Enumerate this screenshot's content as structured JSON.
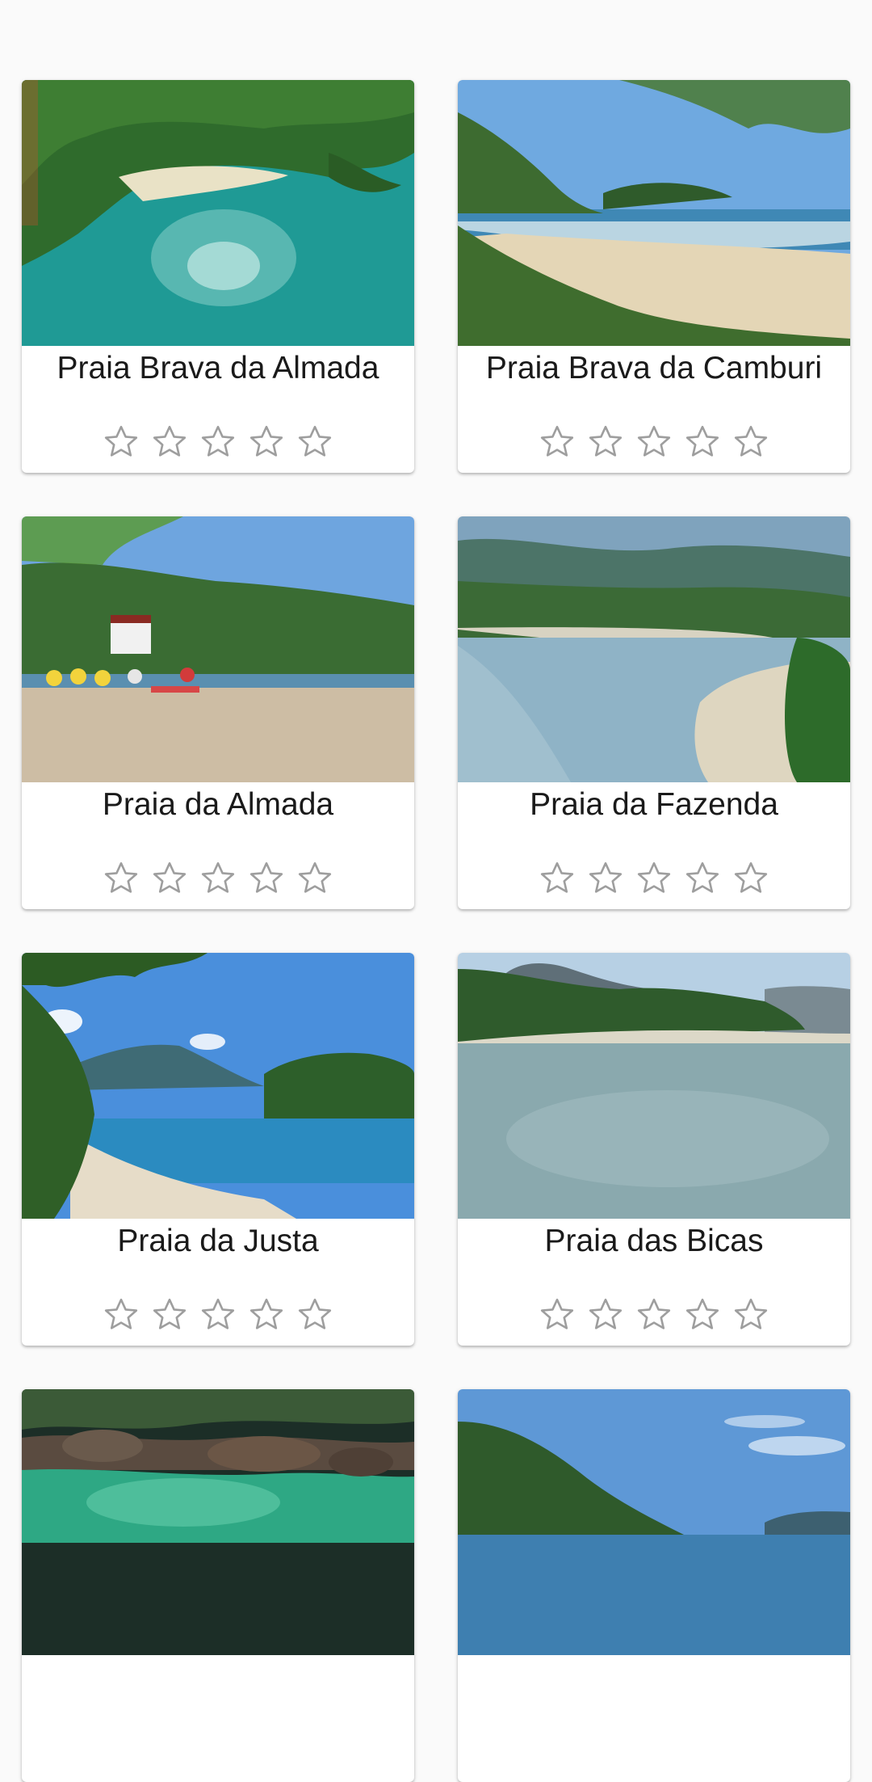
{
  "beaches": [
    {
      "name": "Praia Brava da Almada",
      "rating": 0,
      "max_rating": 5,
      "scene": "aerial-cove-icon"
    },
    {
      "name": "Praia Brava da Camburi",
      "rating": 0,
      "max_rating": 5,
      "scene": "beach-with-trees-icon"
    },
    {
      "name": "Praia da Almada",
      "rating": 0,
      "max_rating": 5,
      "scene": "busy-beach-icon"
    },
    {
      "name": "Praia da Fazenda",
      "rating": 0,
      "max_rating": 5,
      "scene": "river-mouth-icon"
    },
    {
      "name": "Praia da Justa",
      "rating": 0,
      "max_rating": 5,
      "scene": "bay-mountains-icon"
    },
    {
      "name": "Praia das Bicas",
      "rating": 0,
      "max_rating": 5,
      "scene": "calm-lagoon-icon"
    },
    {
      "name": "",
      "rating": 0,
      "max_rating": 5,
      "scene": "rocky-stream-icon"
    },
    {
      "name": "",
      "rating": 0,
      "max_rating": 5,
      "scene": "hillside-sky-icon"
    }
  ],
  "colors": {
    "background": "#fafafa",
    "card": "#ffffff",
    "star_outline": "#9e9e9e",
    "title_text": "#1a1a1a"
  }
}
